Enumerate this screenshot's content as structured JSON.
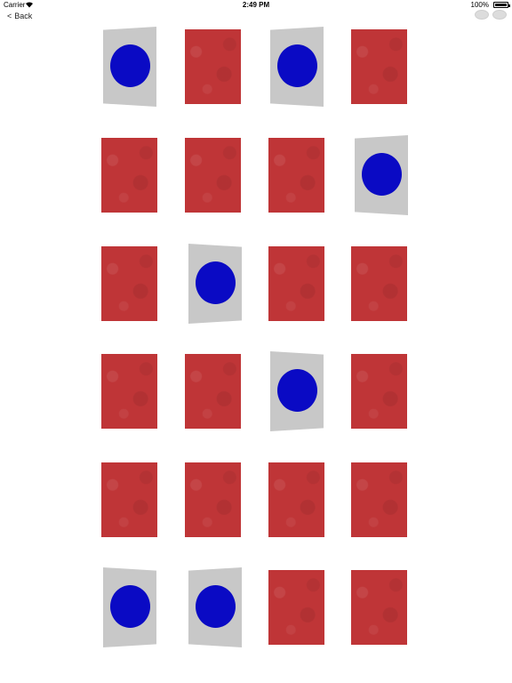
{
  "status_bar": {
    "carrier": "Carrier",
    "time": "2:49 PM",
    "battery": "100%"
  },
  "nav": {
    "back_label": "Back"
  },
  "board": {
    "rows": 6,
    "cols": 4,
    "cards": [
      [
        "face-up",
        "face-down",
        "face-up",
        "face-down"
      ],
      [
        "face-down",
        "face-down",
        "face-down",
        "face-up"
      ],
      [
        "face-down",
        "face-up",
        "face-down",
        "face-down"
      ],
      [
        "face-down",
        "face-down",
        "face-up",
        "face-down"
      ],
      [
        "face-down",
        "face-down",
        "face-down",
        "face-down"
      ],
      [
        "face-up",
        "face-up",
        "face-down",
        "face-down"
      ]
    ],
    "card_back_color": "#bf3537",
    "card_front_color": "#c8c8c8",
    "symbol": "blue-circle",
    "symbol_color": "#0a0ac4"
  }
}
